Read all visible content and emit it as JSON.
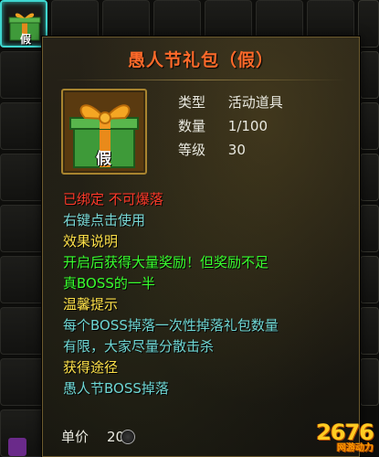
{
  "inventory": {
    "selected_slot_badge": "假"
  },
  "tooltip": {
    "title": "愚人节礼包（假）",
    "icon_badge": "假",
    "stats": [
      {
        "key": "类型",
        "value": "活动道具"
      },
      {
        "key": "数量",
        "value": "1/100"
      },
      {
        "key": "等级",
        "value": "30"
      }
    ],
    "bind_status": "已绑定 不可爆落",
    "usage_hint": "右键点击使用",
    "effect_heading": "效果说明",
    "effect_lines": [
      "开启后获得大量奖励！但奖励不足",
      "真BOSS的一半"
    ],
    "tip_heading": "温馨提示",
    "tip_lines": [
      "每个BOSS掉落一次性掉落礼包数量",
      "有限，大家尽量分散击杀"
    ],
    "source_heading": "获得途径",
    "source_line": "愚人节BOSS掉落",
    "price_label": "单价",
    "price_value": "20",
    "colors": {
      "title": "#ff6a2a",
      "bound": "#ff3a2a",
      "usage": "#7ad9d6",
      "heading": "#ffe24a",
      "effect": "#39ff2e",
      "tip": "#6fd7d4"
    }
  },
  "watermark": {
    "brand": "2676",
    "subtitle": "网游动力"
  }
}
